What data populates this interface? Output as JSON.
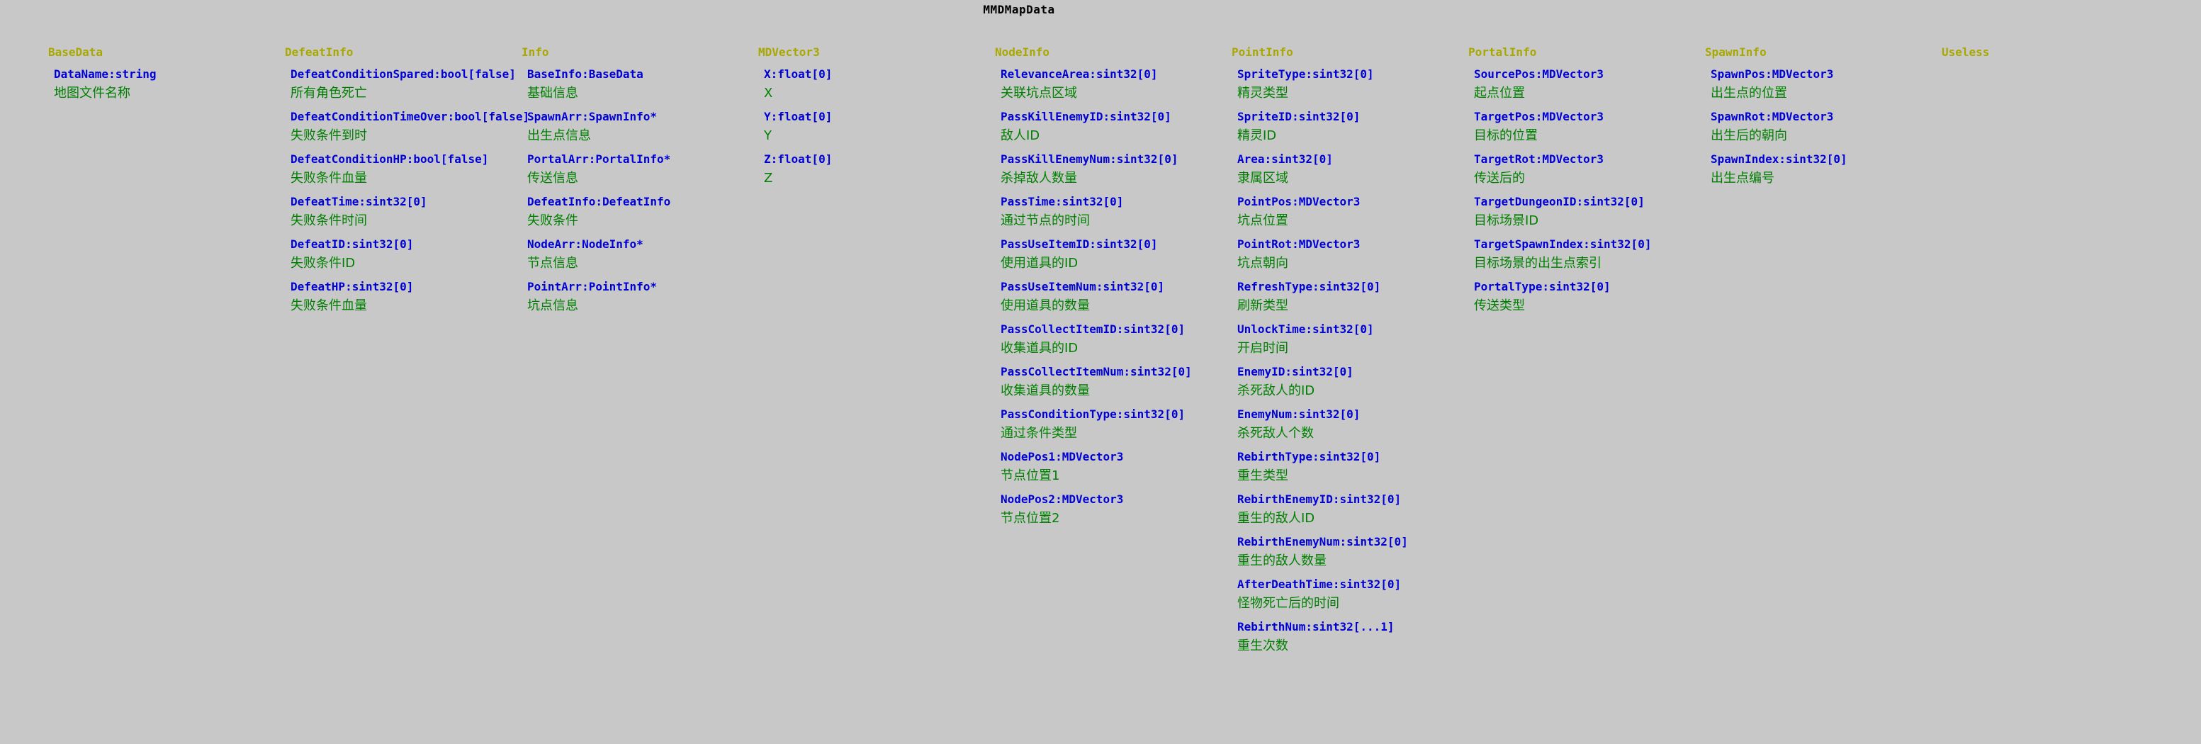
{
  "title": "MMDMapData",
  "columns": [
    {
      "header": "BaseData",
      "fields": [
        {
          "type": "DataName:string",
          "desc": "地图文件名称"
        }
      ]
    },
    {
      "header": "DefeatInfo",
      "fields": [
        {
          "type": "DefeatConditionSpared:bool[false]",
          "desc": "所有角色死亡"
        },
        {
          "type": "DefeatConditionTimeOver:bool[false]",
          "desc": "失败条件到时"
        },
        {
          "type": "DefeatConditionHP:bool[false]",
          "desc": "失败条件血量"
        },
        {
          "type": "DefeatTime:sint32[0]",
          "desc": "失败条件时间"
        },
        {
          "type": "DefeatID:sint32[0]",
          "desc": "失败条件ID"
        },
        {
          "type": "DefeatHP:sint32[0]",
          "desc": "失败条件血量"
        }
      ]
    },
    {
      "header": "Info",
      "fields": [
        {
          "type": "BaseInfo:BaseData",
          "desc": "基础信息"
        },
        {
          "type": "SpawnArr:SpawnInfo*",
          "desc": "出生点信息"
        },
        {
          "type": "PortalArr:PortalInfo*",
          "desc": "传送信息"
        },
        {
          "type": "DefeatInfo:DefeatInfo",
          "desc": "失败条件"
        },
        {
          "type": "NodeArr:NodeInfo*",
          "desc": "节点信息"
        },
        {
          "type": "PointArr:PointInfo*",
          "desc": "坑点信息"
        }
      ]
    },
    {
      "header": "MDVector3",
      "fields": [
        {
          "type": "X:float[0]",
          "desc": "X"
        },
        {
          "type": "Y:float[0]",
          "desc": "Y"
        },
        {
          "type": "Z:float[0]",
          "desc": "Z"
        }
      ]
    },
    {
      "header": "NodeInfo",
      "fields": [
        {
          "type": "RelevanceArea:sint32[0]",
          "desc": "关联坑点区域"
        },
        {
          "type": "PassKillEnemyID:sint32[0]",
          "desc": "敌人ID"
        },
        {
          "type": "PassKillEnemyNum:sint32[0]",
          "desc": "杀掉敌人数量"
        },
        {
          "type": "PassTime:sint32[0]",
          "desc": "通过节点的时间"
        },
        {
          "type": "PassUseItemID:sint32[0]",
          "desc": "使用道具的ID"
        },
        {
          "type": "PassUseItemNum:sint32[0]",
          "desc": "使用道具的数量"
        },
        {
          "type": "PassCollectItemID:sint32[0]",
          "desc": "收集道具的ID"
        },
        {
          "type": "PassCollectItemNum:sint32[0]",
          "desc": "收集道具的数量"
        },
        {
          "type": "PassConditionType:sint32[0]",
          "desc": "通过条件类型"
        },
        {
          "type": "NodePos1:MDVector3",
          "desc": "节点位置1"
        },
        {
          "type": "NodePos2:MDVector3",
          "desc": "节点位置2"
        }
      ]
    },
    {
      "header": "PointInfo",
      "fields": [
        {
          "type": "SpriteType:sint32[0]",
          "desc": "精灵类型"
        },
        {
          "type": "SpriteID:sint32[0]",
          "desc": "精灵ID"
        },
        {
          "type": "Area:sint32[0]",
          "desc": "隶属区域"
        },
        {
          "type": "PointPos:MDVector3",
          "desc": "坑点位置"
        },
        {
          "type": "PointRot:MDVector3",
          "desc": "坑点朝向"
        },
        {
          "type": "RefreshType:sint32[0]",
          "desc": "刷新类型"
        },
        {
          "type": "UnlockTime:sint32[0]",
          "desc": "开启时间"
        },
        {
          "type": "EnemyID:sint32[0]",
          "desc": "杀死敌人的ID"
        },
        {
          "type": "EnemyNum:sint32[0]",
          "desc": "杀死敌人个数"
        },
        {
          "type": "RebirthType:sint32[0]",
          "desc": "重生类型"
        },
        {
          "type": "RebirthEnemyID:sint32[0]",
          "desc": "重生的敌人ID"
        },
        {
          "type": "RebirthEnemyNum:sint32[0]",
          "desc": "重生的敌人数量"
        },
        {
          "type": "AfterDeathTime:sint32[0]",
          "desc": "怪物死亡后的时间"
        },
        {
          "type": "RebirthNum:sint32[...1]",
          "desc": "重生次数"
        }
      ]
    },
    {
      "header": "PortalInfo",
      "fields": [
        {
          "type": "SourcePos:MDVector3",
          "desc": "起点位置"
        },
        {
          "type": "TargetPos:MDVector3",
          "desc": "目标的位置"
        },
        {
          "type": "TargetRot:MDVector3",
          "desc": "传送后的"
        },
        {
          "type": "TargetDungeonID:sint32[0]",
          "desc": "目标场景ID"
        },
        {
          "type": "TargetSpawnIndex:sint32[0]",
          "desc": "目标场景的出生点索引"
        },
        {
          "type": "PortalType:sint32[0]",
          "desc": "传送类型"
        }
      ]
    },
    {
      "header": "SpawnInfo",
      "fields": [
        {
          "type": "SpawnPos:MDVector3",
          "desc": "出生点的位置"
        },
        {
          "type": "SpawnRot:MDVector3",
          "desc": "出生后的朝向"
        },
        {
          "type": "SpawnIndex:sint32[0]",
          "desc": "出生点编号"
        }
      ]
    },
    {
      "header": "Useless",
      "fields": []
    }
  ],
  "colors": {
    "background": "#c8c8c8",
    "header": "#a8a800",
    "type": "#0000d8",
    "desc": "#008000",
    "title": "#000000"
  }
}
